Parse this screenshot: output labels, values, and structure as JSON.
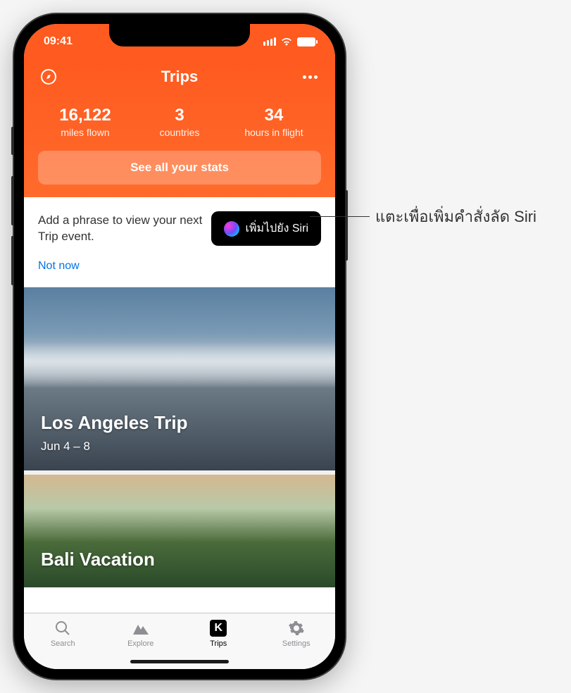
{
  "status_bar": {
    "time": "09:41"
  },
  "header": {
    "title": "Trips",
    "stats": [
      {
        "value": "16,122",
        "label": "miles flown"
      },
      {
        "value": "3",
        "label": "countries"
      },
      {
        "value": "34",
        "label": "hours in flight"
      }
    ],
    "stats_button": "See all your stats"
  },
  "siri_card": {
    "prompt": "Add a phrase to view your next Trip event.",
    "button_label": "เพิ่มไปยัง Siri",
    "not_now": "Not now"
  },
  "trips": [
    {
      "title": "Los Angeles Trip",
      "dates": "Jun 4 – 8"
    },
    {
      "title": "Bali Vacation",
      "dates": ""
    }
  ],
  "tabs": [
    {
      "label": "Search"
    },
    {
      "label": "Explore"
    },
    {
      "label": "Trips"
    },
    {
      "label": "Settings"
    }
  ],
  "callout": {
    "text": "แตะเพื่อเพิ่มคำสั่งลัด Siri"
  }
}
